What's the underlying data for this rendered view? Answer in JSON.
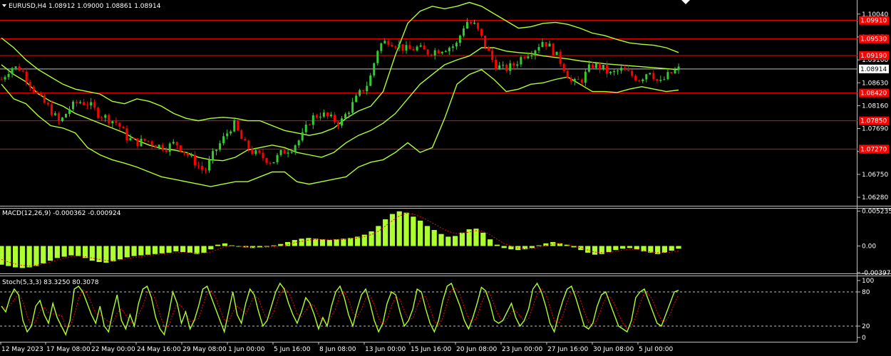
{
  "header": {
    "main_title": "EURUSD,H4  1.08912 1.09000 1.08861 1.08914",
    "macd_title": "MACD(12,26,9) -0.000362 -0.000924",
    "stoch_title": "Stoch(5,3,3) 83.3250 80.3078"
  },
  "colors": {
    "background": "#000000",
    "bull_candle": "#32cd32",
    "bear_candle": "#ff0000",
    "bands": "#adff2f",
    "hlines": "#ff0000",
    "hline_tag": "#ff0000",
    "macd_hist": "#adff2f",
    "macd_signal": "#ff0000",
    "stoch_main": "#adff2f",
    "stoch_signal": "#ff0000",
    "axis": "#c0c0c0"
  },
  "chart_data": [
    {
      "type": "candlestick",
      "title": "EURUSD,H4  1.08912 1.09000 1.08861 1.08914",
      "ylim": [
        1.0612,
        1.103
      ],
      "y_ticks": [
        "1.10040",
        "1.09570",
        "1.09100",
        "1.08630",
        "1.08160",
        "1.07690",
        "1.07220",
        "1.06750",
        "1.06280"
      ],
      "current_price": "1.08914",
      "horizontal_levels": [
        "1.09910",
        "1.09530",
        "1.09190",
        "1.08420",
        "1.07850",
        "1.07270"
      ],
      "x_labels": [
        "12 May 2023",
        "17 May 08:00",
        "22 May 00:00",
        "24 May 16:00",
        "29 May 08:00",
        "1 Jun 00:00",
        "5 Jun 16:00",
        "8 Jun 08:00",
        "13 Jun 00:00",
        "15 Jun 16:00",
        "20 Jun 08:00",
        "23 Jun 00:00",
        "27 Jun 16:00",
        "30 Jun 08:00",
        "5 Jul 00:00"
      ],
      "close_path": [
        1.087,
        1.0895,
        1.0892,
        1.086,
        1.083,
        1.081,
        1.078,
        1.081,
        1.0825,
        1.082,
        1.08,
        1.079,
        1.078,
        1.075,
        1.074,
        1.0745,
        1.0735,
        1.073,
        1.074,
        1.072,
        1.07,
        1.068,
        1.072,
        1.075,
        1.078,
        1.074,
        1.072,
        1.071,
        1.07,
        1.072,
        1.073,
        1.075,
        1.079,
        1.08,
        1.079,
        1.078,
        1.081,
        1.084,
        1.0865,
        1.094,
        1.095,
        1.094,
        1.093,
        1.0935,
        1.0925,
        1.093,
        1.0935,
        1.094,
        1.099,
        1.098,
        1.094,
        1.09,
        1.089,
        1.09,
        1.092,
        1.093,
        1.095,
        1.093,
        1.09,
        1.086,
        1.087,
        1.09,
        1.0895,
        1.088,
        1.089,
        1.088,
        1.087,
        1.089,
        1.086,
        1.088,
        1.0891
      ],
      "bollinger": {
        "upper": [
          1.0955,
          1.0935,
          1.091,
          1.089,
          1.0875,
          1.086,
          1.085,
          1.0845,
          1.084,
          1.0825,
          1.082,
          1.083,
          1.0825,
          1.0815,
          1.08,
          1.079,
          1.0785,
          1.079,
          1.0792,
          1.079,
          1.0785,
          1.0785,
          1.0775,
          1.0765,
          1.076,
          1.0755,
          1.076,
          1.077,
          1.079,
          1.0805,
          1.0815,
          1.0845,
          1.092,
          1.0985,
          1.101,
          1.102,
          1.1015,
          1.102,
          1.1028,
          1.102,
          1.1005,
          1.099,
          1.0975,
          1.0978,
          1.0985,
          1.0987,
          1.0983,
          1.0975,
          1.0965,
          1.096,
          1.0952,
          1.0945,
          1.0942,
          1.094,
          1.0935,
          1.0925
        ],
        "middle": [
          1.09,
          1.088,
          1.0865,
          1.084,
          1.0825,
          1.0815,
          1.08,
          1.079,
          1.078,
          1.077,
          1.076,
          1.0745,
          1.0735,
          1.0728,
          1.0725,
          1.072,
          1.071,
          1.0705,
          1.0703,
          1.071,
          1.0725,
          1.073,
          1.0735,
          1.073,
          1.072,
          1.0715,
          1.071,
          1.072,
          1.074,
          1.0755,
          1.0765,
          1.078,
          1.08,
          1.083,
          1.086,
          1.088,
          1.09,
          1.091,
          1.0918,
          1.0935,
          1.0935,
          1.0928,
          1.0925,
          1.0923,
          1.0918,
          1.0915,
          1.0912,
          1.0908,
          1.0905,
          1.0902,
          1.09,
          1.0898,
          1.0896,
          1.0894,
          1.0892,
          1.089
        ],
        "lower": [
          1.086,
          1.083,
          1.082,
          1.0795,
          1.0775,
          1.077,
          1.076,
          1.073,
          1.0715,
          1.0705,
          1.0698,
          1.069,
          1.068,
          1.067,
          1.0665,
          1.066,
          1.0655,
          1.065,
          1.0655,
          1.066,
          1.066,
          1.067,
          1.068,
          1.068,
          1.066,
          1.0655,
          1.066,
          1.0665,
          1.067,
          1.069,
          1.07,
          1.0705,
          1.072,
          1.074,
          1.072,
          1.073,
          1.079,
          1.086,
          1.088,
          1.089,
          1.087,
          1.0845,
          1.085,
          1.086,
          1.0863,
          1.087,
          1.0875,
          1.086,
          1.0845,
          1.0845,
          1.0843,
          1.085,
          1.0855,
          1.085,
          1.0845,
          1.0848
        ]
      }
    },
    {
      "type": "bar",
      "title": "MACD(12,26,9) -0.000362 -0.000924",
      "ylim": [
        -0.004,
        0.0055
      ],
      "y_ticks": [
        "0.005235",
        "0.00",
        "-0.003974"
      ],
      "histogram": [
        -0.0028,
        -0.003,
        -0.0032,
        -0.0033,
        -0.0032,
        -0.003,
        -0.0026,
        -0.0022,
        -0.0018,
        -0.0016,
        -0.0014,
        -0.0015,
        -0.0018,
        -0.0022,
        -0.0024,
        -0.0025,
        -0.0023,
        -0.002,
        -0.0017,
        -0.0015,
        -0.0014,
        -0.0013,
        -0.0012,
        -0.0011,
        -0.001,
        -0.0008,
        -0.0009,
        -0.001,
        -0.0012,
        -0.001,
        -0.0005,
        0.0002,
        0.0004,
        0.0001,
        -0.0001,
        -0.0002,
        -0.0003,
        -0.0002,
        -0.0001,
        0.0001,
        0.0003,
        0.0006,
        0.0009,
        0.0011,
        0.0012,
        0.0011,
        0.001,
        0.0009,
        0.001,
        0.0011,
        0.0012,
        0.0014,
        0.0017,
        0.0022,
        0.003,
        0.004,
        0.0048,
        0.0052,
        0.005,
        0.0044,
        0.0038,
        0.003,
        0.0024,
        0.0018,
        0.0014,
        0.0015,
        0.002,
        0.0025,
        0.0026,
        0.002,
        0.001,
        0.0002,
        -0.0003,
        -0.0005,
        -0.0006,
        -0.0005,
        -0.0003,
        0.0001,
        0.0004,
        0.0006,
        0.0004,
        0.0002,
        -0.0002,
        -0.0006,
        -0.001,
        -0.0013,
        -0.0012,
        -0.0009,
        -0.0006,
        -0.0004,
        -0.0003,
        -0.0005,
        -0.0008,
        -0.001,
        -0.0012,
        -0.001,
        -0.0007,
        -0.0004
      ],
      "signal": [
        -0.002,
        -0.0024,
        -0.0027,
        -0.0029,
        -0.003,
        -0.0029,
        -0.0027,
        -0.0024,
        -0.0021,
        -0.0018,
        -0.0016,
        -0.0015,
        -0.0016,
        -0.0018,
        -0.002,
        -0.0022,
        -0.0022,
        -0.0021,
        -0.0019,
        -0.0017,
        -0.0016,
        -0.0014,
        -0.0013,
        -0.0012,
        -0.0011,
        -0.001,
        -0.001,
        -0.001,
        -0.0011,
        -0.0011,
        -0.0009,
        -0.0005,
        -0.0001,
        0.0,
        0.0,
        -0.0001,
        -0.0002,
        -0.0002,
        -0.0002,
        -0.0001,
        0.0,
        0.0002,
        0.0005,
        0.0007,
        0.0009,
        0.001,
        0.001,
        0.001,
        0.001,
        0.001,
        0.0011,
        0.0012,
        0.0014,
        0.0017,
        0.0022,
        0.003,
        0.0038,
        0.0045,
        0.0049,
        0.0048,
        0.0044,
        0.0039,
        0.0033,
        0.0027,
        0.0022,
        0.0019,
        0.0019,
        0.0021,
        0.0023,
        0.0022,
        0.0017,
        0.001,
        0.0004,
        0.0,
        -0.0003,
        -0.0004,
        -0.0004,
        -0.0002,
        0.0001,
        0.0003,
        0.0003,
        0.0002,
        0.0,
        -0.0003,
        -0.0006,
        -0.0009,
        -0.001,
        -0.001,
        -0.0008,
        -0.0006,
        -0.0005,
        -0.0005,
        -0.0007,
        -0.0009,
        -0.001,
        -0.001,
        -0.0009,
        -0.0007
      ]
    },
    {
      "type": "line",
      "title": "Stoch(5,3,3) 83.3250 80.3078",
      "ylim": [
        0,
        100
      ],
      "y_ticks": [
        "100",
        "80",
        "20",
        "0"
      ],
      "levels": [
        80,
        20
      ],
      "main": [
        55,
        45,
        70,
        85,
        75,
        30,
        10,
        20,
        55,
        65,
        40,
        25,
        60,
        35,
        20,
        5,
        30,
        85,
        90,
        80,
        60,
        40,
        25,
        55,
        20,
        10,
        45,
        75,
        30,
        15,
        40,
        20,
        60,
        85,
        90,
        70,
        35,
        15,
        5,
        40,
        80,
        60,
        25,
        45,
        15,
        30,
        55,
        85,
        90,
        70,
        50,
        30,
        10,
        45,
        80,
        40,
        25,
        60,
        85,
        75,
        45,
        20,
        30,
        55,
        80,
        95,
        85,
        60,
        40,
        25,
        45,
        70,
        60,
        40,
        15,
        35,
        20,
        55,
        80,
        90,
        70,
        40,
        20,
        50,
        75,
        85,
        60,
        30,
        10,
        25,
        60,
        80,
        75,
        45,
        20,
        30,
        50,
        85,
        80,
        50,
        25,
        10,
        30,
        65,
        90,
        95,
        75,
        55,
        30,
        15,
        35,
        60,
        88,
        82,
        60,
        30,
        25,
        30,
        45,
        60,
        35,
        20,
        30,
        50,
        85,
        95,
        80,
        55,
        25,
        10,
        40,
        65,
        85,
        90,
        70,
        45,
        20,
        15,
        25,
        55,
        75,
        80,
        60,
        40,
        20,
        15,
        10,
        30,
        70,
        80,
        85,
        65,
        45,
        25,
        20,
        40,
        60,
        80,
        83
      ]
    }
  ]
}
